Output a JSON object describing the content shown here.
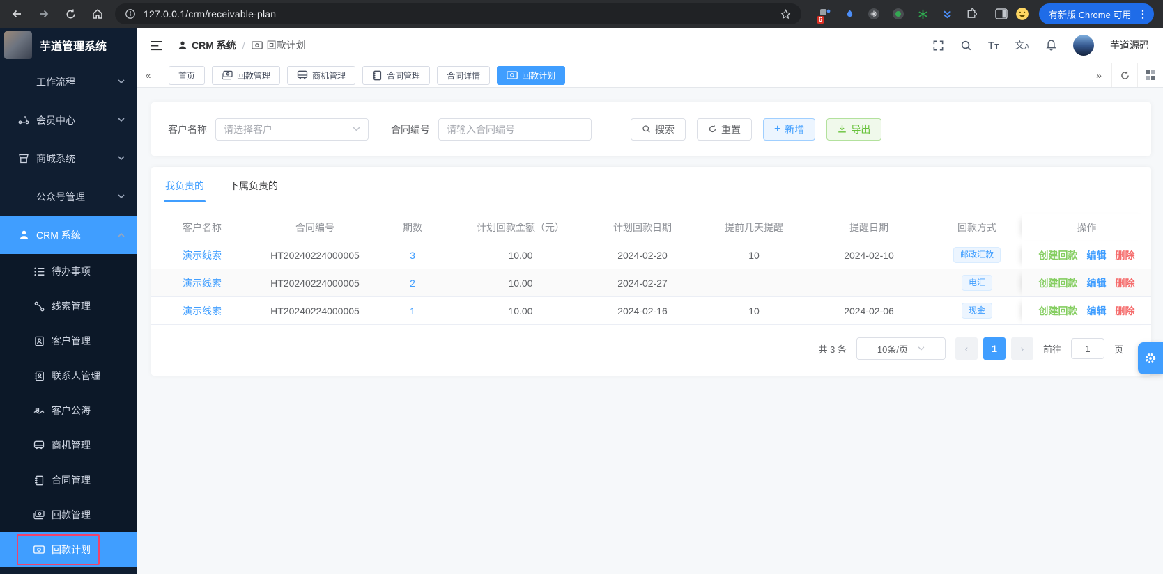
{
  "browser": {
    "url": "127.0.0.1/crm/receivable-plan",
    "extension_badge": "6",
    "update_button": "有新版 Chrome 可用"
  },
  "sidebar": {
    "logo_title": "芋道管理系统",
    "items": [
      {
        "label": "工作流程",
        "chevron": "down",
        "top": true
      },
      {
        "label": "会员中心",
        "icon": "scooter-icon",
        "chevron": "down",
        "top": true
      },
      {
        "label": "商城系统",
        "icon": "shop-icon",
        "chevron": "down",
        "top": true
      },
      {
        "label": "公众号管理",
        "chevron": "down",
        "top": true
      },
      {
        "label": "CRM 系统",
        "icon": "user-icon",
        "chevron": "up",
        "top": true,
        "active": true
      },
      {
        "label": "待办事项",
        "icon": "todo-list-icon",
        "sub": true
      },
      {
        "label": "线索管理",
        "icon": "clue-icon",
        "sub": true
      },
      {
        "label": "客户管理",
        "icon": "customer-book-icon",
        "sub": true
      },
      {
        "label": "联系人管理",
        "icon": "contact-book-icon",
        "sub": true
      },
      {
        "label": "客户公海",
        "icon": "open-sea-icon",
        "sub": true
      },
      {
        "label": "商机管理",
        "icon": "business-bus-icon",
        "sub": true
      },
      {
        "label": "合同管理",
        "icon": "contract-notebook-icon",
        "sub": true
      },
      {
        "label": "回款管理",
        "icon": "receivable-money-icon",
        "sub": true
      },
      {
        "label": "回款计划",
        "icon": "banknote-icon",
        "sub": true,
        "active": true,
        "highlighted": true
      }
    ]
  },
  "header": {
    "breadcrumb_root": "CRM 系统",
    "breadcrumb_sep": "/",
    "breadcrumb_current": "回款计划",
    "username": "芋道源码"
  },
  "nav_tabs": [
    {
      "label": "首页"
    },
    {
      "label": "回款管理",
      "icon": "receivable-money-icon"
    },
    {
      "label": "商机管理",
      "icon": "business-bus-icon"
    },
    {
      "label": "合同管理",
      "icon": "contract-notebook-icon"
    },
    {
      "label": "合同详情"
    },
    {
      "label": "回款计划",
      "icon": "banknote-icon",
      "active": true
    }
  ],
  "filter": {
    "customer_label": "客户名称",
    "customer_placeholder": "请选择客户",
    "contract_label": "合同编号",
    "contract_placeholder": "请输入合同编号",
    "search_label": "搜索",
    "reset_label": "重置",
    "add_label": "新增",
    "export_label": "导出"
  },
  "panel": {
    "tab_mine": "我负责的",
    "tab_subordinate": "下属负责的"
  },
  "table": {
    "columns": [
      "客户名称",
      "合同编号",
      "期数",
      "计划回款金额（元）",
      "计划回款日期",
      "提前几天提醒",
      "提醒日期",
      "回款方式",
      "操作"
    ],
    "rows": [
      {
        "customer": "演示线索",
        "contract_no": "HT20240224000005",
        "period": "3",
        "amount": "10.00",
        "plan_date": "2024-02-20",
        "remind_days": "10",
        "remind_date": "2024-02-10",
        "method": "邮政汇款"
      },
      {
        "customer": "演示线索",
        "contract_no": "HT20240224000005",
        "period": "2",
        "amount": "10.00",
        "plan_date": "2024-02-27",
        "remind_days": "",
        "remind_date": "",
        "method": "电汇",
        "striped": true
      },
      {
        "customer": "演示线索",
        "contract_no": "HT20240224000005",
        "period": "1",
        "amount": "10.00",
        "plan_date": "2024-02-16",
        "remind_days": "10",
        "remind_date": "2024-02-06",
        "method": "现金"
      }
    ],
    "row_actions": [
      "创建回款",
      "编辑",
      "删除"
    ]
  },
  "pagination": {
    "total": "共 3 条",
    "page_size": "10条/页",
    "current_page": "1",
    "goto_label": "前往",
    "goto_value": "1",
    "page_unit": "页"
  },
  "colors": {
    "accent": "#409eff",
    "success": "#67c23a",
    "danger": "#f56c6c",
    "tag_bg": "#ecf5ff",
    "sidebar_bg": "#101e31",
    "highlight_border": "#f0436b"
  }
}
